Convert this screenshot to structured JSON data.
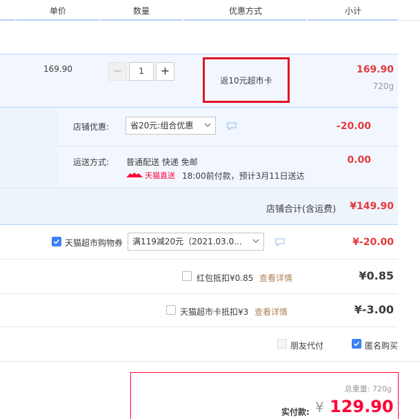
{
  "header": {
    "col_price": "单价",
    "col_qty": "数量",
    "col_promo": "优惠方式",
    "col_subtotal": "小计"
  },
  "item": {
    "price": "169.90",
    "qty_minus": "−",
    "quantity": "1",
    "qty_plus": "+",
    "promo": "返10元超市卡",
    "subtotal": "169.90",
    "weight": "720g"
  },
  "shop": {
    "discount_label": "店铺优惠:",
    "discount_select": "省20元:组合优惠",
    "discount_amount": "-20.00",
    "shipping_label": "运送方式:",
    "shipping_text": "普通配送 快递 免邮",
    "tmall_badge": "天猫直送",
    "delivery_note": "18:00前付款，预计3月11日送达",
    "shipping_amount": "0.00",
    "total_label": "店铺合计(含运费)",
    "total_amount": "¥149.90"
  },
  "coupon": {
    "label": "天猫超市购物券",
    "checked": true,
    "select": "满119减20元（2021.03.0...",
    "amount": "¥-20.00"
  },
  "redpacket": {
    "label": "红包抵扣¥0.85",
    "checked": false,
    "link": "查看详情",
    "amount": "¥0.85"
  },
  "supercard": {
    "label": "天猫超市卡抵扣¥3",
    "checked": false,
    "link": "查看详情",
    "amount": "¥-3.00"
  },
  "options": {
    "friend_pay": "朋友代付",
    "friend_pay_checked": false,
    "anonymous": "匿名购买",
    "anonymous_checked": true
  },
  "summary": {
    "weight_label": "总重量:",
    "weight_value": "720g",
    "pay_label": "实付款:",
    "currency": "¥",
    "pay_amount": "129.90"
  },
  "colors": {
    "accent_red": "#e4393c",
    "tmall_red": "#ff0036",
    "highlight_border": "#e1141f",
    "checkbox_blue": "#3c7ff5",
    "link_brown": "#b08157"
  }
}
